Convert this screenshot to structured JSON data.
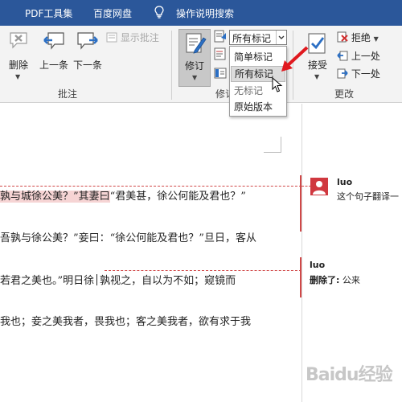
{
  "tabs": [
    "PDF工具集",
    "百度网盘",
    "操作说明搜索"
  ],
  "ribbon": {
    "comments_group": {
      "label": "批注",
      "delete": "删除",
      "previous": "上一条",
      "next": "下一条",
      "show_comments": "显示批注"
    },
    "tracking_group": {
      "label_visible": "修订",
      "track_changes": "修订",
      "markup_selected": "所有标记",
      "dropdown_options": [
        "简单标记",
        "所有标记",
        "无标记",
        "原始版本"
      ],
      "hovered_option": "所有标记"
    },
    "changes_group": {
      "label": "更改",
      "accept": "接受",
      "reject": "拒绝",
      "previous": "上一处",
      "next": "下一处"
    }
  },
  "document": {
    "lines": [
      {
        "before": "孰与城徐公美？”其妻曰",
        "highlighted": "孰与城徐公美？”其妻曰",
        "after": "“君美甚，徐公何能及君也？”"
      },
      {
        "text": "吾孰与徐公美？”妾曰：“徐公何能及君也？”旦日，客从"
      },
      {
        "before": "若君之美也。”明日徐",
        "after": "孰视之，自以为不如；窥镜而"
      },
      {
        "text": "我也；妾之美我者，畏我也；客之美我者，欲有求于我"
      }
    ]
  },
  "comments": [
    {
      "author": "luo",
      "text": "这个句子翻译一"
    },
    {
      "author": "luo",
      "label": "删除了:",
      "text": "公来"
    }
  ],
  "watermark": "Baidu经验",
  "colors": {
    "ribbon_tabbar": "#2b579a",
    "markup_red": "#d04848",
    "highlight": "#f6d4d4"
  }
}
